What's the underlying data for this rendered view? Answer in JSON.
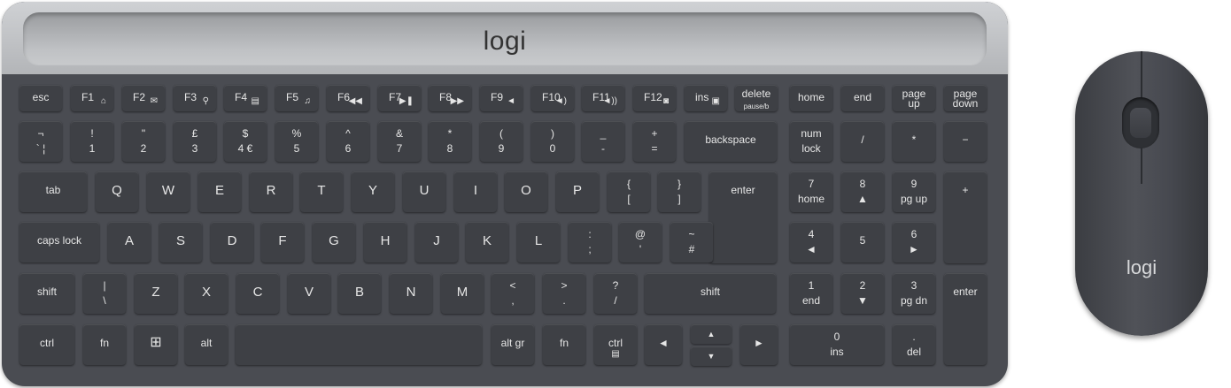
{
  "keyboard": {
    "logo": "logi",
    "rows": [
      [
        {
          "top": "esc"
        },
        {
          "top": "F1",
          "icon": "⌂"
        },
        {
          "top": "F2",
          "icon": "✉"
        },
        {
          "top": "F3",
          "icon": "⚲"
        },
        {
          "top": "F4",
          "icon": "▤"
        },
        {
          "top": "F5",
          "icon": "♫"
        },
        {
          "top": "F6",
          "icon": "◀◀"
        },
        {
          "top": "F7",
          "icon": "▶❚"
        },
        {
          "top": "F8",
          "icon": "▶▶"
        },
        {
          "top": "F9",
          "icon": "◄"
        },
        {
          "top": "F10",
          "icon": "◄)"
        },
        {
          "top": "F11",
          "icon": "◄))"
        },
        {
          "top": "F12",
          "icon": "◙"
        },
        {
          "top": "ins",
          "icon": "▣"
        },
        {
          "top": "delete",
          "sub": "pause/b"
        },
        {
          "top": "home"
        },
        {
          "top": "end"
        },
        {
          "top": "page",
          "bottom": "up"
        },
        {
          "top": "page",
          "bottom": "down"
        }
      ],
      [
        {
          "top": "¬",
          "bottom": "` ¦"
        },
        {
          "top": "!",
          "bottom": "1"
        },
        {
          "top": "\"",
          "bottom": "2"
        },
        {
          "top": "£",
          "bottom": "3"
        },
        {
          "top": "$",
          "bottom": "4 €"
        },
        {
          "top": "%",
          "bottom": "5"
        },
        {
          "top": "^",
          "bottom": "6"
        },
        {
          "top": "&",
          "bottom": "7"
        },
        {
          "top": "*",
          "bottom": "8"
        },
        {
          "top": "(",
          "bottom": "9"
        },
        {
          "top": ")",
          "bottom": "0"
        },
        {
          "top": "_",
          "bottom": "-"
        },
        {
          "top": "+",
          "bottom": "="
        },
        {
          "top": "backspace"
        },
        {
          "top": "num",
          "bottom": "lock"
        },
        {
          "top": "/"
        },
        {
          "top": "*"
        },
        {
          "top": "−"
        }
      ],
      [
        {
          "top": "tab"
        },
        {
          "top": "Q"
        },
        {
          "top": "W"
        },
        {
          "top": "E"
        },
        {
          "top": "R"
        },
        {
          "top": "T"
        },
        {
          "top": "Y"
        },
        {
          "top": "U"
        },
        {
          "top": "I"
        },
        {
          "top": "O"
        },
        {
          "top": "P"
        },
        {
          "top": "{",
          "bottom": "["
        },
        {
          "top": "}",
          "bottom": "]"
        },
        {
          "top": "enter"
        },
        {
          "top": "7",
          "bottom": "home"
        },
        {
          "top": "8",
          "bottom": "▲"
        },
        {
          "top": "9",
          "bottom": "pg up"
        },
        {
          "top": "+"
        }
      ],
      [
        {
          "top": "caps lock"
        },
        {
          "top": "A"
        },
        {
          "top": "S"
        },
        {
          "top": "D"
        },
        {
          "top": "F"
        },
        {
          "top": "G"
        },
        {
          "top": "H"
        },
        {
          "top": "J"
        },
        {
          "top": "K"
        },
        {
          "top": "L"
        },
        {
          "top": ":",
          "bottom": ";"
        },
        {
          "top": "@",
          "bottom": "'"
        },
        {
          "top": "~",
          "bottom": "#"
        },
        {
          "top": "4",
          "bottom": "◄"
        },
        {
          "top": "5"
        },
        {
          "top": "6",
          "bottom": "►"
        }
      ],
      [
        {
          "top": "shift"
        },
        {
          "top": "|",
          "bottom": "\\"
        },
        {
          "top": "Z"
        },
        {
          "top": "X"
        },
        {
          "top": "C"
        },
        {
          "top": "V"
        },
        {
          "top": "B"
        },
        {
          "top": "N"
        },
        {
          "top": "M"
        },
        {
          "top": "<",
          "bottom": ","
        },
        {
          "top": ">",
          "bottom": "."
        },
        {
          "top": "?",
          "bottom": "/"
        },
        {
          "top": "shift"
        },
        {
          "top": "1",
          "bottom": "end"
        },
        {
          "top": "2",
          "bottom": "▼"
        },
        {
          "top": "3",
          "bottom": "pg dn"
        },
        {
          "top": "enter"
        }
      ],
      [
        {
          "top": "ctrl"
        },
        {
          "top": "fn"
        },
        {
          "icon": "⊞"
        },
        {
          "top": "alt"
        },
        {
          "top": ""
        },
        {
          "top": "alt gr"
        },
        {
          "top": "fn"
        },
        {
          "top": "ctrl",
          "icon": "▤"
        },
        {
          "top": "◄"
        },
        {
          "top": "▲"
        },
        {
          "top": "▼"
        },
        {
          "top": "►"
        },
        {
          "top": "0",
          "bottom": "ins"
        },
        {
          "top": ".",
          "bottom": "del"
        }
      ]
    ]
  },
  "mouse": {
    "logo": "logi"
  }
}
